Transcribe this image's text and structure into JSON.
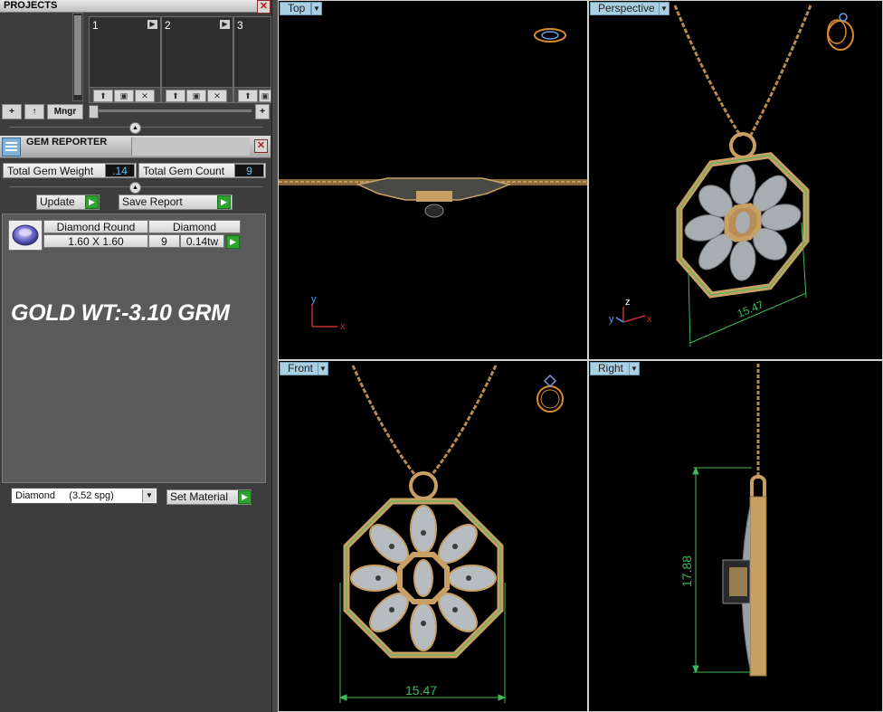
{
  "projects": {
    "title": "PROJECTS",
    "slots": [
      {
        "number": "1"
      },
      {
        "number": "2"
      },
      {
        "number": "3"
      }
    ],
    "toolbar": {
      "add": "+",
      "up": "↑",
      "manager": "Mngr",
      "add_right": "+"
    }
  },
  "gem_reporter": {
    "title": "GEM REPORTER",
    "total_weight_label": "Total Gem Weight",
    "total_weight_value": ".14",
    "total_count_label": "Total Gem Count",
    "total_count_value": "9",
    "update_label": "Update",
    "save_report_label": "Save Report",
    "rows": [
      {
        "shape": "Diamond Round",
        "size": "1.60 X 1.60",
        "type": "Diamond",
        "count": "9",
        "weight": "0.14tw"
      }
    ],
    "note": "GOLD WT:-3.10 GRM",
    "material_value": "Diamond     (3.52 spg)",
    "set_material_label": "Set Material"
  },
  "viewports": {
    "top": {
      "label": "Top"
    },
    "perspective": {
      "label": "Perspective",
      "dimension": "15.47"
    },
    "front": {
      "label": "Front",
      "dimension": "15.47"
    },
    "right": {
      "label": "Right",
      "dimension": "17.88"
    }
  },
  "axes": {
    "x": "x",
    "y": "y",
    "z": "z"
  },
  "colors": {
    "metal": "#c8a064",
    "metal_dark": "#8a6a3a",
    "gem_silver": "#b7bcc0",
    "dimension": "#3fb85a",
    "viewport_tab": "#a9cfe2",
    "go_button": "#2ea42e",
    "value_text": "#60c0ff"
  }
}
